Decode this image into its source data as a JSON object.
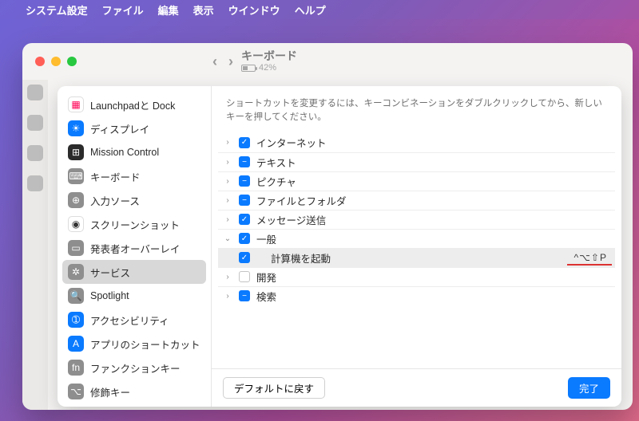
{
  "menubar": {
    "app": "システム設定",
    "items": [
      "ファイル",
      "編集",
      "表示",
      "ウインドウ",
      "ヘルプ"
    ]
  },
  "outer": {
    "title": "キーボード",
    "battery_pct": "42%"
  },
  "sidebar": {
    "items": [
      {
        "label": "Launchpadと Dock",
        "icon_bg": "#ffffff",
        "icon_border": true,
        "glyph": "▦",
        "glyph_color": "#f05"
      },
      {
        "label": "ディスプレイ",
        "icon_bg": "#0a7aff",
        "glyph": "☀"
      },
      {
        "label": "Mission Control",
        "icon_bg": "#2b2b2b",
        "glyph": "⊞"
      },
      {
        "label": "キーボード",
        "icon_bg": "#8e8e8e",
        "glyph": "⌨"
      },
      {
        "label": "入力ソース",
        "icon_bg": "#8e8e8e",
        "glyph": "⊕"
      },
      {
        "label": "スクリーンショット",
        "icon_bg": "#ffffff",
        "icon_border": true,
        "glyph": "◉",
        "glyph_color": "#333"
      },
      {
        "label": "発表者オーバーレイ",
        "icon_bg": "#8e8e8e",
        "glyph": "▭"
      },
      {
        "label": "サービス",
        "icon_bg": "#8e8e8e",
        "glyph": "✲",
        "active": true
      },
      {
        "label": "Spotlight",
        "icon_bg": "#8e8e8e",
        "glyph": "🔍"
      },
      {
        "label": "アクセシビリティ",
        "icon_bg": "#0a7aff",
        "glyph": "➀"
      },
      {
        "label": "アプリのショートカット",
        "icon_bg": "#0a7aff",
        "glyph": "A"
      },
      {
        "label": "ファンクションキー",
        "icon_bg": "#8e8e8e",
        "glyph": "fn"
      },
      {
        "label": "修飾キー",
        "icon_bg": "#8e8e8e",
        "glyph": "⌥"
      }
    ]
  },
  "help_text": "ショートカットを変更するには、キーコンビネーションをダブルクリックしてから、新しいキーを押してください。",
  "rows": [
    {
      "label": "インターネット",
      "check": "on",
      "disclosure": "right"
    },
    {
      "label": "テキスト",
      "check": "mixed",
      "disclosure": "right"
    },
    {
      "label": "ピクチャ",
      "check": "mixed",
      "disclosure": "right"
    },
    {
      "label": "ファイルとフォルダ",
      "check": "mixed",
      "disclosure": "right"
    },
    {
      "label": "メッセージ送信",
      "check": "on",
      "disclosure": "right"
    },
    {
      "label": "一般",
      "check": "on",
      "disclosure": "down"
    },
    {
      "label": "計算機を起動",
      "check": "on",
      "child": true,
      "shortcut": "^⌥⇧P",
      "highlight": true
    },
    {
      "label": "開発",
      "check": "off",
      "disclosure": "right"
    },
    {
      "label": "検索",
      "check": "mixed",
      "disclosure": "right"
    }
  ],
  "footer": {
    "restore": "デフォルトに戻す",
    "done": "完了"
  }
}
